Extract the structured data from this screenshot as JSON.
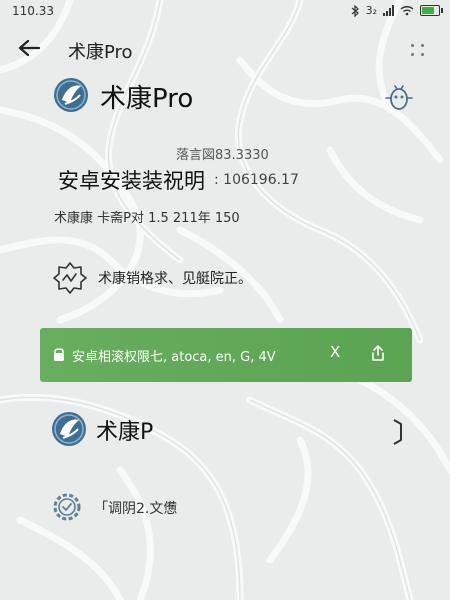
{
  "status_bar": {
    "time": "110.33",
    "signal_label": "3₂",
    "battery_level": 0.8,
    "icons": [
      "bluetooth-icon",
      "signal-icon",
      "wifi-icon",
      "battery-icon"
    ]
  },
  "header": {
    "title": "术康Pro",
    "icons": [
      "back-arrow-icon",
      "more-dots-icon"
    ]
  },
  "app": {
    "name": "术康Pro",
    "icons": [
      "app-logo-icon",
      "bug-icon"
    ]
  },
  "version_line": "落言図83.3330",
  "install": {
    "title": "安卓安装装祝明",
    "code": ": 106196.17"
  },
  "meta_line": "术康康  卡斋P对 1.5  211年 150",
  "notice": {
    "text": "术康销格求、见艇院正。",
    "icon": "alert-badge-icon"
  },
  "permission_banner": {
    "text": "安卓相滚权限七, atoca, en, G, 4V",
    "close_label": "X",
    "color": "#5eaa55",
    "icons": [
      "lock-icon",
      "share-icon"
    ]
  },
  "app_secondary": {
    "name": "术康P",
    "icons": [
      "app-logo-icon",
      "scan-bracket-icon"
    ]
  },
  "settings_row": {
    "text": "「调阴2.文憊",
    "icon": "settings-gear-icon"
  },
  "colors": {
    "accent_blue": "#3d6f95",
    "banner_green": "#5eaa55",
    "background": "#e9eaea"
  }
}
